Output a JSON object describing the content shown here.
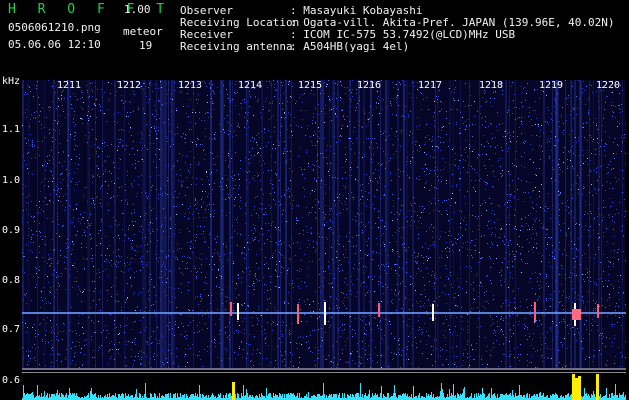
{
  "header": {
    "app_name": "H R O F F T",
    "version": "1.00",
    "file_name": "0506061210.png",
    "datetime": "05.06.06 12:10",
    "meteor_label": "meteor",
    "meteor_count": "19"
  },
  "station": {
    "observer_label": "Observer",
    "observer_value": ": Masayuki Kobayashi",
    "location_label": "Receiving Location",
    "location_value": ": Ogata-vill. Akita-Pref. JAPAN (139.96E, 40.02N)",
    "receiver_label": "Receiver",
    "receiver_value": ": ICOM IC-575 53.7492(@LCD)MHz USB",
    "antenna_label": "Receiving antenna",
    "antenna_value": ": A504HB(yagi 4el)"
  },
  "axis": {
    "unit": "kHz",
    "y_labels": [
      "1.1",
      "1.0",
      "0.9",
      "0.8",
      "0.7",
      "0.6"
    ],
    "time_labels": [
      "1211",
      "1212",
      "1213",
      "1214",
      "1215",
      "1216",
      "1217",
      "1218",
      "1219",
      "1220"
    ]
  },
  "colors": {
    "text_green": "#19d24a",
    "background": "#050528",
    "signal": "#6aa0ff",
    "strip": "#36e0ff",
    "strong": "#ffee00"
  }
}
